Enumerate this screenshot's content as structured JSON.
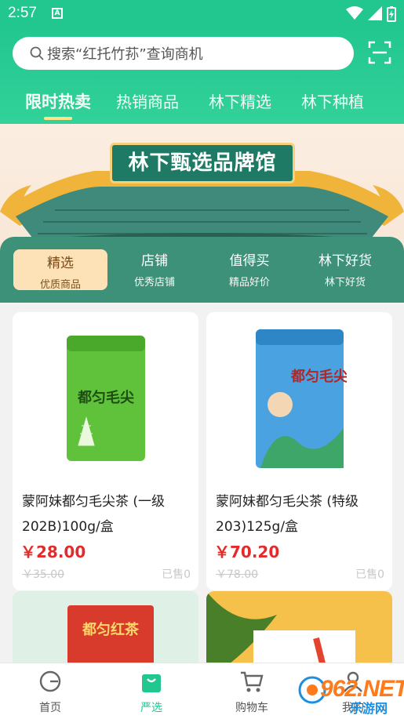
{
  "status_bar": {
    "time": "2:57",
    "a_badge": "A"
  },
  "search": {
    "placeholder": "搜索“红托竹荪”查询商机"
  },
  "tabs": [
    {
      "label": "限时热卖",
      "active": true
    },
    {
      "label": "热销商品"
    },
    {
      "label": "林下精选"
    },
    {
      "label": "林下种植"
    }
  ],
  "banner": {
    "title": "林下甄选品牌馆"
  },
  "categories": [
    {
      "title": "精选",
      "sub": "优质商品",
      "active": true
    },
    {
      "title": "店铺",
      "sub": "优秀店铺"
    },
    {
      "title": "值得买",
      "sub": "精品好价"
    },
    {
      "title": "林下好货",
      "sub": "林下好货"
    }
  ],
  "products": [
    {
      "name": "蒙阿妹都匀毛尖茶 (一级202B)100g/盒",
      "price": "￥28.00",
      "orig": "￥35.00",
      "sold": "已售0",
      "pkg_text": "都匀毛尖"
    },
    {
      "name": "蒙阿妹都匀毛尖茶 (特级203)125g/盒",
      "price": "￥70.20",
      "orig": "￥78.00",
      "sold": "已售0",
      "pkg_text": "都匀毛尖"
    },
    {
      "pkg_text": "都匀红茶"
    },
    {
      "pkg_text": ""
    }
  ],
  "bottom_nav": [
    {
      "label": "首页"
    },
    {
      "label": "严选",
      "active": true
    },
    {
      "label": "购物车"
    },
    {
      "label": "我的"
    }
  ],
  "watermark": {
    "brand": "962.NET",
    "sub": "乐游网"
  },
  "colors": {
    "brand_green": "#22c68f",
    "price_red": "#e32b2b",
    "banner_green": "#1e7a64"
  }
}
